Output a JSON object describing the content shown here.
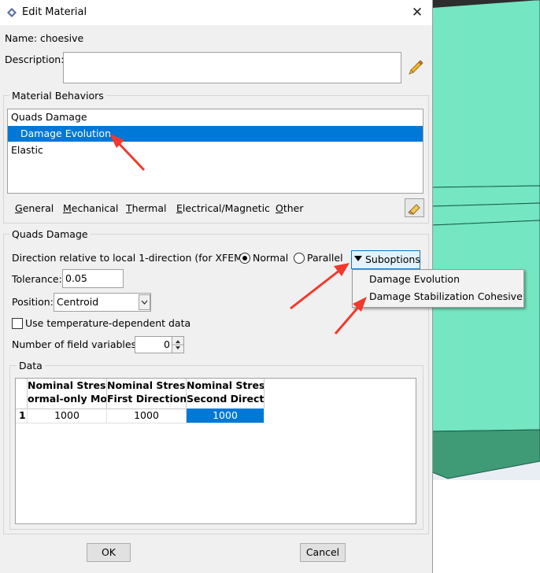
{
  "window": {
    "title": "Edit Material"
  },
  "material": {
    "name_label": "Name:",
    "name_value": "choesive",
    "description_label": "Description:",
    "description_value": ""
  },
  "behaviors": {
    "group_title": "Material Behaviors",
    "items": [
      {
        "label": "Quads Damage",
        "indent": false,
        "selected": false
      },
      {
        "label": "Damage Evolution",
        "indent": true,
        "selected": true
      },
      {
        "label": "Elastic",
        "indent": false,
        "selected": false
      }
    ]
  },
  "menu": {
    "items": [
      "General",
      "Mechanical",
      "Thermal",
      "Electrical/Magnetic",
      "Other"
    ]
  },
  "section": {
    "title": "Quads Damage",
    "direction_label": "Direction relative to local 1-direction (for XFEM):",
    "radio_normal": "Normal",
    "radio_parallel": "Parallel",
    "selected_direction": "Normal",
    "suboptions_label": "Suboptions",
    "tolerance_label": "Tolerance:",
    "tolerance_value": "0.05",
    "position_label": "Position:",
    "position_value": "Centroid",
    "temp_label": "Use temperature-dependent data",
    "temp_checked": false,
    "field_vars_label": "Number of field variables:",
    "field_vars_value": "0"
  },
  "data": {
    "group_title": "Data",
    "columns": [
      {
        "line1": "Nominal Stress",
        "line2": "ormal-only Mod"
      },
      {
        "line1": "Nominal Stress",
        "line2": "First Direction"
      },
      {
        "line1": "Nominal Stress",
        "line2": "Second Directio"
      }
    ],
    "rows": [
      {
        "index": "1",
        "cells": [
          "1000",
          "1000",
          "1000"
        ]
      }
    ]
  },
  "suboptions_menu": {
    "items": [
      "Damage Evolution",
      "Damage Stabilization Cohesive"
    ]
  },
  "buttons": {
    "ok": "OK",
    "cancel": "Cancel"
  },
  "colors": {
    "selection": "#0078d7",
    "annotation_arrow": "#f03a2e",
    "viewport_mesh": "#74e6c1"
  },
  "icons": [
    "app-icon",
    "close-icon",
    "pencil-icon",
    "eraser-icon",
    "dropdown-arrow-icon",
    "spinner-icon"
  ]
}
